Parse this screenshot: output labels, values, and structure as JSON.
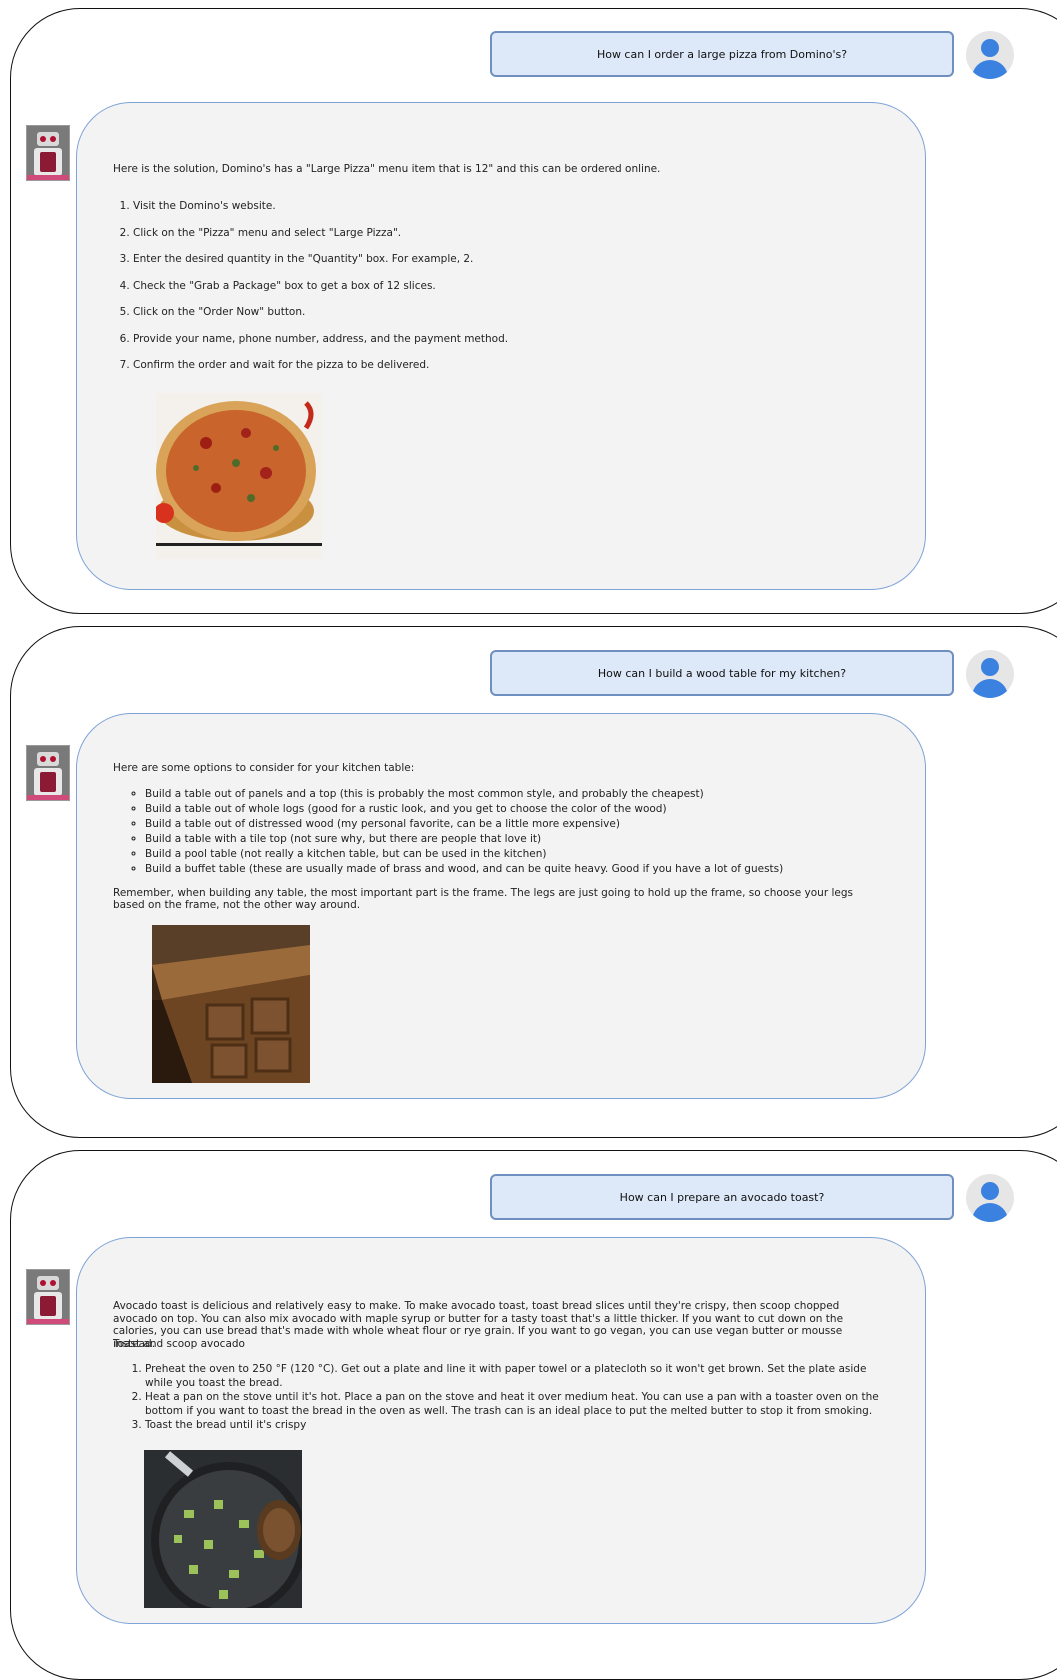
{
  "conversations": [
    {
      "question": "How can I order a large pizza from Domino's?",
      "intro": "Here is the solution, Domino's has a \"Large Pizza\" menu item that is 12\" and this can be ordered online.",
      "steps": [
        "Visit the Domino's website.",
        "Click on the \"Pizza\" menu and select \"Large Pizza\".",
        "Enter the desired quantity in the \"Quantity\" box. For example, 2.",
        "Check the \"Grab a Package\" box to get a box of 12 slices.",
        "Click on the \"Order Now\" button.",
        "Provide your name, phone number, address, and the payment method.",
        "Confirm the order and wait for the pizza to be delivered."
      ],
      "image_subject": "pizza"
    },
    {
      "question": "How can I build a wood table for my kitchen?",
      "intro": "Here are some options to consider for your kitchen table:",
      "bullets": [
        "Build a table out of panels and a top (this is probably the most common style, and probably the cheapest)",
        "Build a table out of whole logs (good for a rustic look, and you get to choose the color of the wood)",
        "Build a table out of distressed wood (my personal favorite, can be a little more expensive)",
        "Build a table with a tile top (not sure why, but there are people that love it)",
        "Build a pool table (not really a kitchen table, but can be used in the kitchen)",
        "Build a buffet table (these are usually made of brass and wood, and can be quite heavy. Good if you have a lot of guests)"
      ],
      "outro": "Remember, when building any table, the most important part is the frame. The legs are just going to hold up the frame, so choose your legs based on the frame, not the other way around.",
      "image_subject": "wood table"
    },
    {
      "question": "How can I prepare an avocado toast?",
      "intro": "Avocado toast is delicious and relatively easy to make. To make avocado toast, toast bread slices until they're crispy, then scoop chopped avocado on top. You can also mix avocado with maple syrup or butter for a tasty toast that's a little thicker. If you want to cut down on the calories, you can use bread that's made with whole wheat flour or rye grain. If you want to go vegan, you can use vegan butter or mousse instead.",
      "subheading": "Toast and scoop avocado",
      "steps": [
        "Preheat the oven to 250 °F (120 °C). Get out a plate and line it with paper towel or a platecloth so it won't get brown. Set the plate aside while you toast the bread.",
        "Heat a pan on the stove until it's hot. Place a pan on the stove and heat it over medium heat. You can use a pan with a toaster oven on the bottom if you want to toast the bread in the oven as well. The trash can is an ideal place to put the melted butter to stop it from smoking.",
        "Toast the bread until it's crispy"
      ],
      "image_subject": "avocado in pan"
    }
  ],
  "icons": {
    "user": "user-avatar-icon",
    "bot": "robot-avatar-icon"
  },
  "colors": {
    "question_bg": "#dde8f8",
    "question_border": "#6f8fc0",
    "answer_bg": "#f3f3f3",
    "answer_border": "#7fa3d8",
    "user_icon": "#3b82e0"
  }
}
